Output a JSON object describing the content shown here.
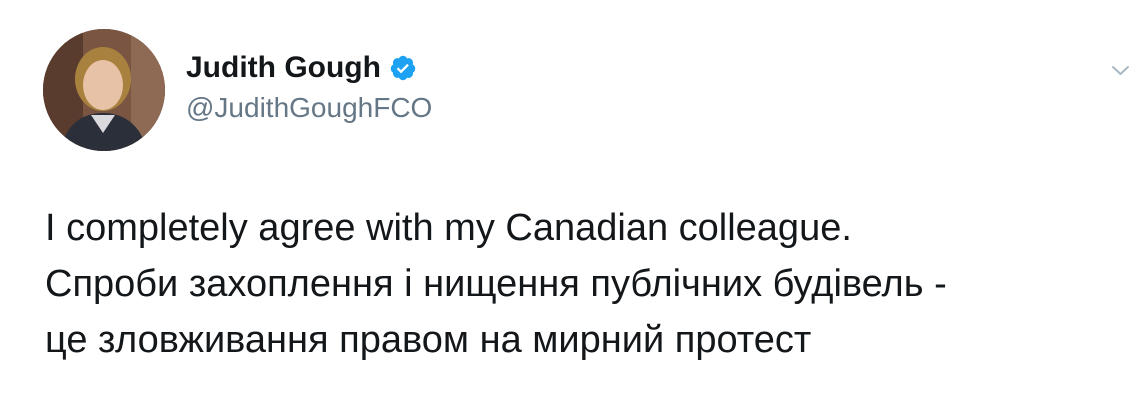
{
  "author": {
    "display_name": "Judith Gough",
    "handle": "@JudithGoughFCO",
    "verified": true,
    "verified_color": "#1da1f2"
  },
  "tweet": {
    "lines": [
      "I completely agree with my Canadian colleague.",
      "Спроби захоплення і нищення публічних будівель -",
      "це зловживання правом на мирний протест"
    ]
  },
  "icons": {
    "verified": "verified-badge-icon",
    "more": "chevron-down-icon"
  },
  "colors": {
    "text": "#14171a",
    "secondary": "#657786",
    "chevron": "#aab8c2"
  }
}
